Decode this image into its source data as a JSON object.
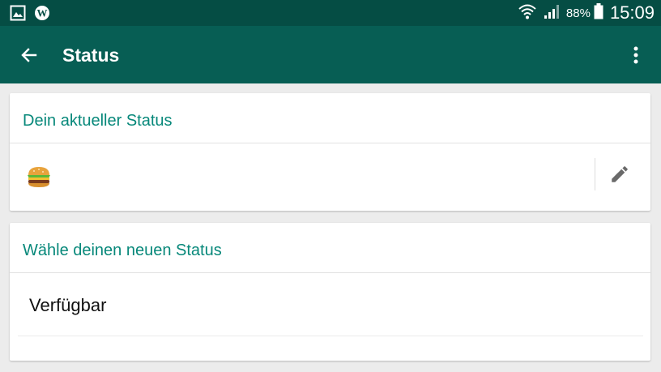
{
  "status_bar": {
    "battery": "88%",
    "time": "15:09",
    "icons": [
      "gallery-notification-icon",
      "wordpress-notification-icon",
      "wifi-icon",
      "cell-signal-icon",
      "battery-icon"
    ]
  },
  "app_bar": {
    "title": "Status",
    "back_icon": "arrow-back-icon",
    "menu_icon": "more-vert-icon"
  },
  "current_status": {
    "header": "Dein aktueller Status",
    "emoji": "hamburger",
    "edit_icon": "pencil-icon"
  },
  "new_status": {
    "header": "Wähle deinen neuen Status",
    "options": [
      "Verfügbar"
    ]
  },
  "colors": {
    "status_bar": "#054d44",
    "app_bar": "#075e54",
    "accent": "#07887a",
    "background": "#ececec"
  }
}
